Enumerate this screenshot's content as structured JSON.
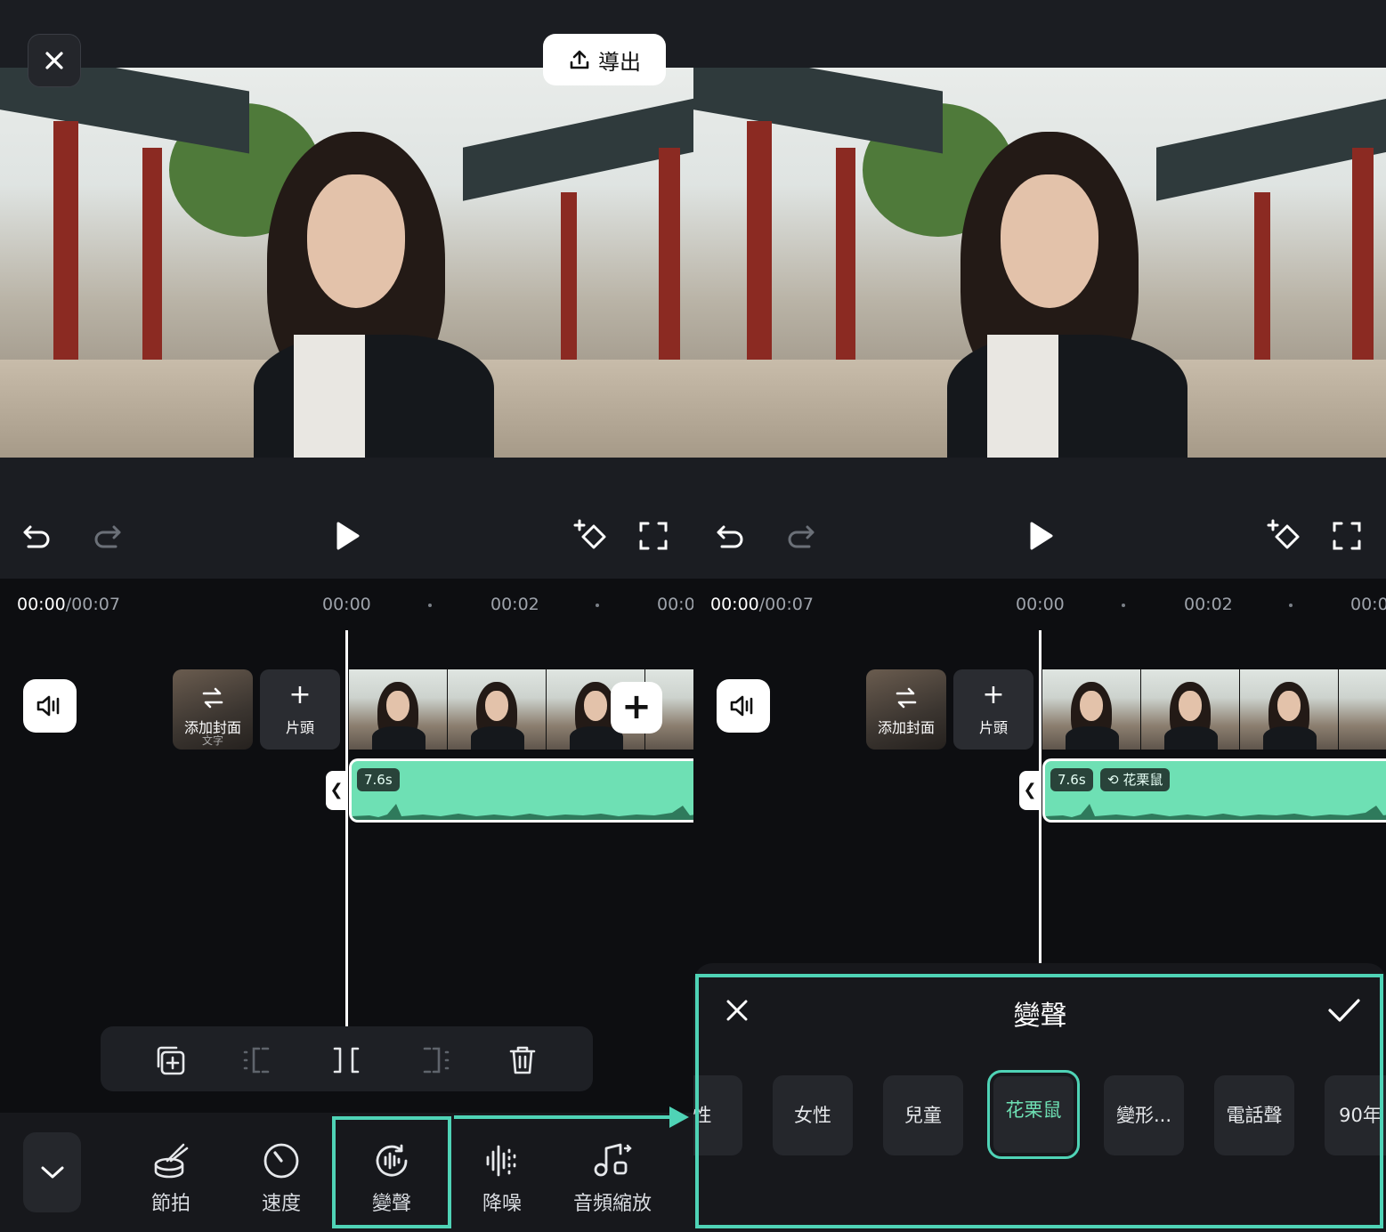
{
  "left": {
    "export_label": "導出",
    "time_current": "00:00",
    "time_total": "/00:07",
    "ticks": [
      "00:00",
      "00:02",
      "00:0"
    ],
    "cover_label": "添加封面",
    "cover_sub": "文字",
    "intro_label": "片頭",
    "clip_duration": "7.6s",
    "bottom_items": [
      {
        "label": "節拍",
        "icon": "beat-icon"
      },
      {
        "label": "速度",
        "icon": "speed-icon"
      },
      {
        "label": "變聲",
        "icon": "voice-changer-icon"
      },
      {
        "label": "降噪",
        "icon": "noise-reduction-icon"
      },
      {
        "label": "音頻縮放",
        "icon": "audio-stretch-icon"
      }
    ]
  },
  "right": {
    "time_current": "00:00",
    "time_total": "/00:07",
    "ticks": [
      "00:00",
      "00:02",
      "00:0"
    ],
    "cover_label": "添加封面",
    "intro_label": "片頭",
    "clip_duration": "7.6s",
    "effect_badge": "花栗鼠",
    "sheet_title": "變聲",
    "voices": [
      "性",
      "女性",
      "兒童",
      "花栗鼠",
      "變形...",
      "電話聲",
      "90年"
    ],
    "selected_voice": "花栗鼠"
  },
  "colors": {
    "accent": "#4fd3b6",
    "audio_track": "#6ee0b4",
    "background": "#0d0e11",
    "panel": "#1b1d22"
  }
}
